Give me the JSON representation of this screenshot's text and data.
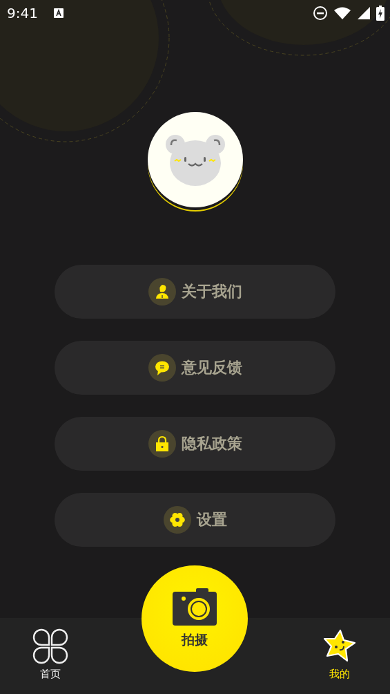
{
  "status_bar": {
    "time": "9:41"
  },
  "menu": [
    {
      "label": "关于我们",
      "kind": "person"
    },
    {
      "label": "意见反馈",
      "kind": "chat"
    },
    {
      "label": "隐私政策",
      "kind": "lock"
    },
    {
      "label": "设置",
      "kind": "gear"
    }
  ],
  "capture_button": {
    "label": "拍摄"
  },
  "tabs": [
    {
      "label": "首页",
      "kind": "clover",
      "selected": false
    },
    {
      "label": "我的",
      "kind": "star",
      "selected": true
    }
  ]
}
